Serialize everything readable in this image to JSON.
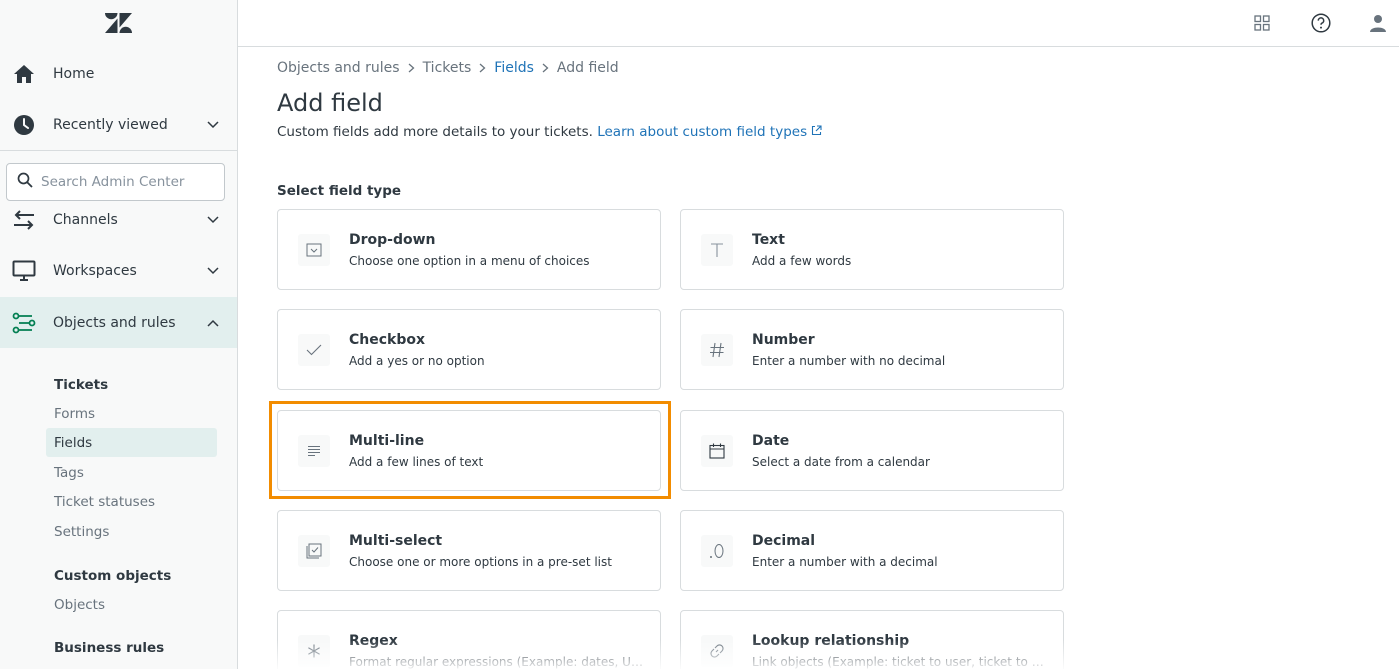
{
  "sidebar": {
    "nav": {
      "home": "Home",
      "recently_viewed": "Recently viewed",
      "channels": "Channels",
      "workspaces": "Workspaces",
      "objects_and_rules": "Objects and rules"
    },
    "search_placeholder": "Search Admin Center",
    "sections": {
      "tickets": {
        "heading": "Tickets",
        "items": [
          "Forms",
          "Fields",
          "Tags",
          "Ticket statuses",
          "Settings"
        ],
        "selected": "Fields"
      },
      "custom_objects": {
        "heading": "Custom objects",
        "items": [
          "Objects"
        ]
      },
      "business_rules": {
        "heading": "Business rules"
      }
    }
  },
  "topbar": {
    "icons": [
      "apps-grid-icon",
      "help-icon",
      "user-icon"
    ]
  },
  "breadcrumb": [
    "Objects and rules",
    "Tickets",
    "Fields",
    "Add field"
  ],
  "page": {
    "title": "Add field",
    "description": "Custom fields add more details to your tickets.",
    "learn_link": "Learn about custom field types",
    "section_label": "Select field type"
  },
  "field_types": [
    {
      "title": "Drop-down",
      "desc": "Choose one option in a menu of choices",
      "icon": "dropdown-icon"
    },
    {
      "title": "Text",
      "desc": "Add a few words",
      "icon": "text-icon"
    },
    {
      "title": "Checkbox",
      "desc": "Add a yes or no option",
      "icon": "checkmark-icon"
    },
    {
      "title": "Number",
      "desc": "Enter a number with no decimal",
      "icon": "hash-icon"
    },
    {
      "title": "Multi-line",
      "desc": "Add a few lines of text",
      "icon": "lines-icon"
    },
    {
      "title": "Date",
      "desc": "Select a date from a calendar",
      "icon": "calendar-icon"
    },
    {
      "title": "Multi-select",
      "desc": "Choose one or more options in a pre-set list",
      "icon": "multiselect-icon"
    },
    {
      "title": "Decimal",
      "desc": "Enter a number with a decimal",
      "icon": "decimal-icon"
    },
    {
      "title": "Regex",
      "desc": "Format regular expressions (Example: dates, URLs)",
      "icon": "asterisk-icon"
    },
    {
      "title": "Lookup relationship",
      "desc": "Link objects (Example: ticket to user, ticket to ticket)",
      "icon": "link-icon"
    }
  ],
  "highlighted_field": "Multi-line",
  "colors": {
    "accent_link": "#1f73b7",
    "highlight": "#f28c00",
    "active_nav": "#e2efee"
  }
}
